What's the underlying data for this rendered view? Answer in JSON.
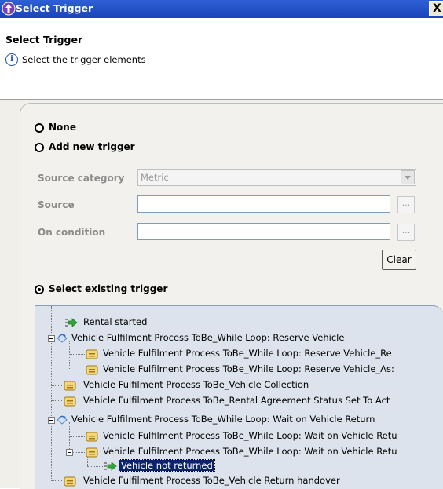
{
  "window": {
    "title": "Select Trigger",
    "close_label": "X"
  },
  "header": {
    "title": "Select Trigger",
    "description": "Select the trigger elements"
  },
  "options": {
    "none_label": "None",
    "add_new_label": "Add new trigger",
    "existing_label": "Select existing trigger",
    "selected": "existing"
  },
  "form": {
    "source_category_label": "Source category",
    "source_category_value": "Metric",
    "source_label": "Source",
    "source_value": "",
    "on_condition_label": "On condition",
    "on_condition_value": "",
    "browse_label": "...",
    "clear_label": "Clear"
  },
  "tree": {
    "items": [
      {
        "label": "Rental started",
        "icon": "trigger-arrow-icon"
      },
      {
        "label": "Vehicle Fulfilment Process ToBe_While Loop: Reserve Vehicle",
        "icon": "loop-icon"
      },
      {
        "label": "Vehicle Fulfilment Process ToBe_While Loop: Reserve Vehicle_Re",
        "icon": "task-icon"
      },
      {
        "label": "Vehicle Fulfilment Process ToBe_While Loop: Reserve Vehicle_As:",
        "icon": "task-icon"
      },
      {
        "label": "Vehicle Fulfilment Process ToBe_Vehicle Collection",
        "icon": "task-icon"
      },
      {
        "label": "Vehicle Fulfilment Process ToBe_Rental Agreement Status Set To Act",
        "icon": "task-icon"
      },
      {
        "label": "Vehicle Fulfilment Process ToBe_While Loop: Wait on Vehicle Return",
        "icon": "loop-icon"
      },
      {
        "label": "Vehicle Fulfilment Process ToBe_While Loop: Wait on Vehicle Retu",
        "icon": "task-icon"
      },
      {
        "label": "Vehicle Fulfilment Process ToBe_While Loop: Wait on Vehicle Retu",
        "icon": "task-icon"
      },
      {
        "label": "Vehicle not returned",
        "icon": "trigger-arrow-icon",
        "selected": true
      },
      {
        "label": "Vehicle Fulfilment Process ToBe_Vehicle Return handover",
        "icon": "task-icon"
      }
    ]
  }
}
